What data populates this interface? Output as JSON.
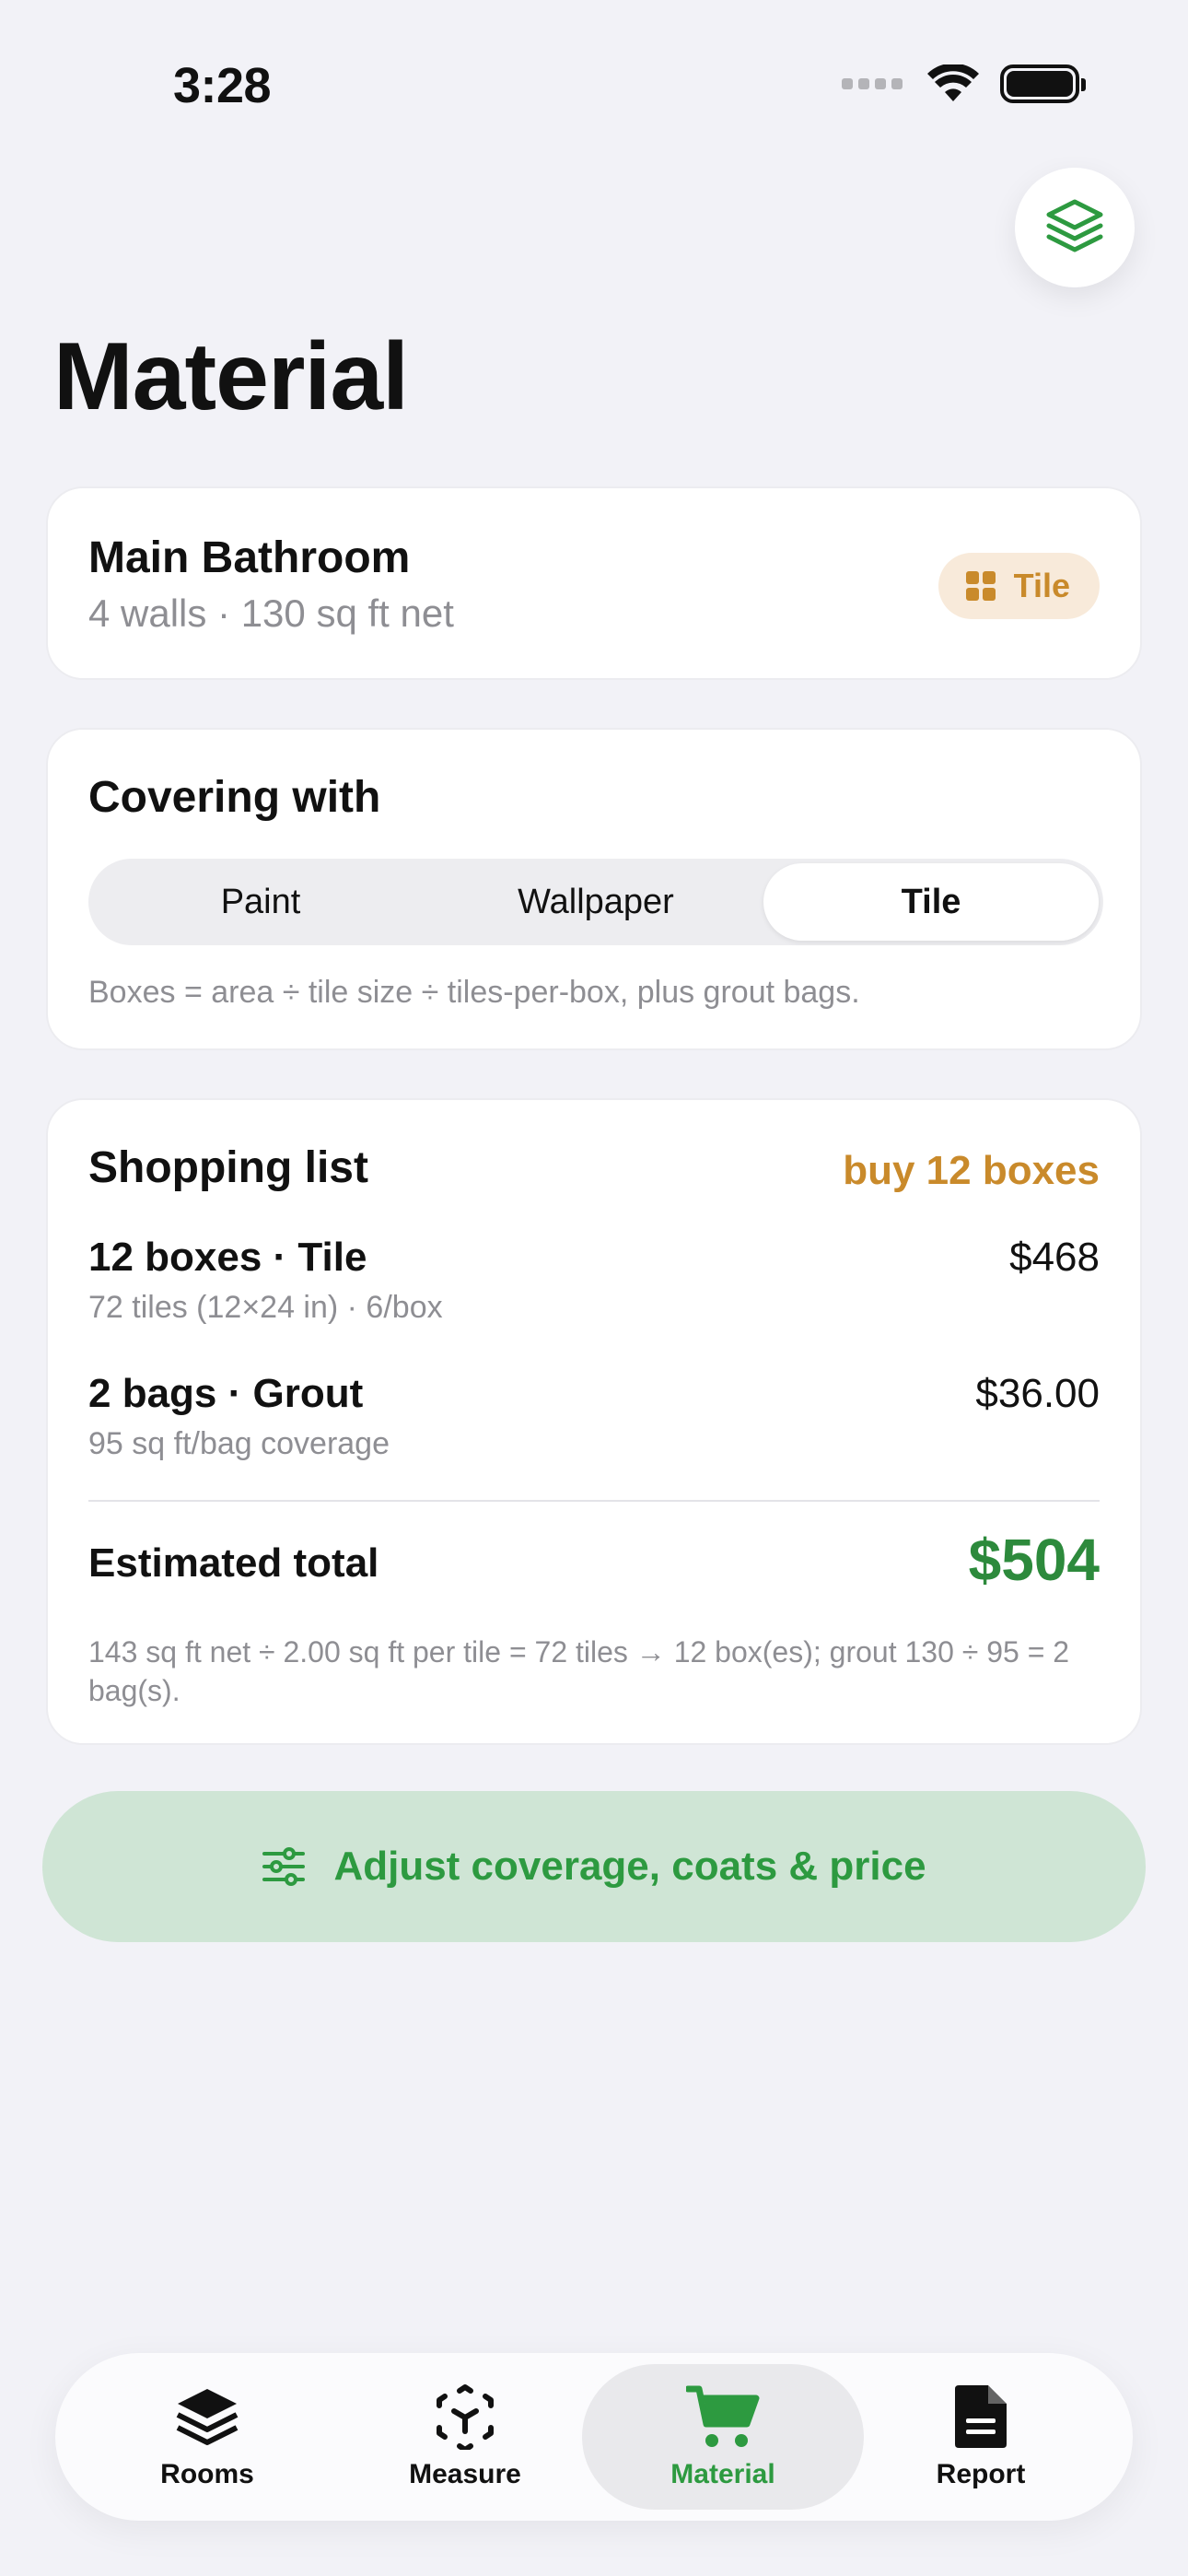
{
  "status": {
    "time": "3:28"
  },
  "header": {
    "title": "Material"
  },
  "room": {
    "name": "Main Bathroom",
    "summary": "4 walls · 130 sq ft net",
    "badge_label": "Tile"
  },
  "covering": {
    "title": "Covering with",
    "options": [
      "Paint",
      "Wallpaper",
      "Tile"
    ],
    "selected": "Tile",
    "hint": "Boxes = area ÷ tile size ÷ tiles-per-box, plus grout bags."
  },
  "shopping": {
    "title": "Shopping list",
    "buy_summary": "buy 12 boxes",
    "items": [
      {
        "title": "12 boxes · Tile",
        "detail": "72 tiles (12×24 in) · 6/box",
        "price": "$468"
      },
      {
        "title": "2 bags · Grout",
        "detail": "95 sq ft/bag coverage",
        "price": "$36.00"
      }
    ],
    "total_label": "Estimated total",
    "total_value": "$504",
    "formula": "143 sq ft net ÷ 2.00 sq ft per tile = 72 tiles → 12 box(es); grout 130 ÷ 95 = 2 bag(s)."
  },
  "adjust_button": {
    "label": "Adjust coverage, coats & price",
    "icon": "sliders-icon"
  },
  "tabbar": {
    "tabs": [
      {
        "label": "Rooms",
        "icon": "layers-icon"
      },
      {
        "label": "Measure",
        "icon": "ar-cube-icon"
      },
      {
        "label": "Material",
        "icon": "cart-icon"
      },
      {
        "label": "Report",
        "icon": "document-icon"
      }
    ],
    "active": "Material"
  },
  "colors": {
    "accent_green": "#2d9a40",
    "tile_orange": "#c98a2b",
    "background": "#f2f2f7"
  }
}
